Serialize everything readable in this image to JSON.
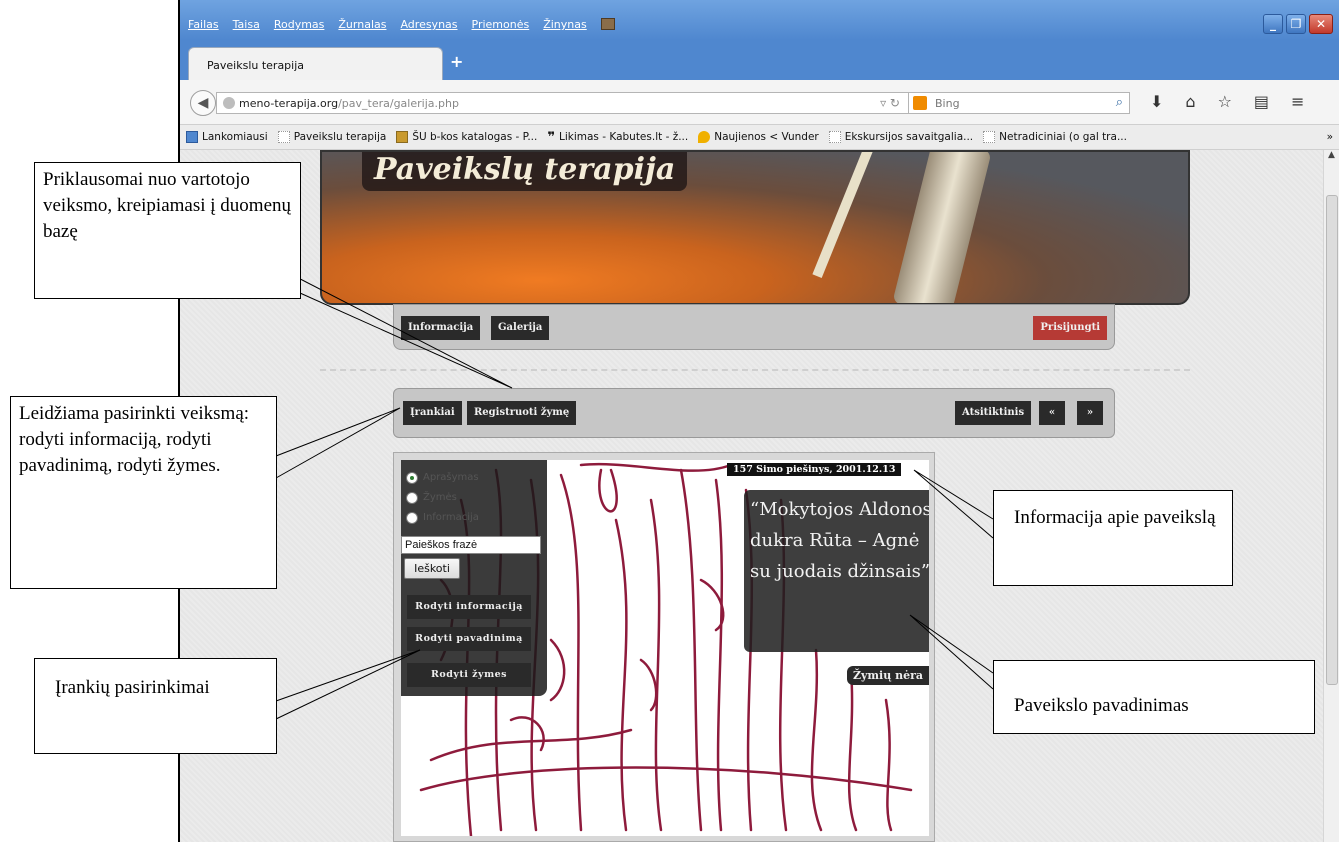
{
  "browser": {
    "menu": [
      "Failas",
      "Taisa",
      "Rodymas",
      "Žurnalas",
      "Adresynas",
      "Priemonės",
      "Žinynas"
    ],
    "tab_title": "Paveikslu terapija",
    "new_tab": "+",
    "url_host": "meno-terapija.org",
    "url_path": "/pav_tera/galerija.php",
    "search_placeholder": "Bing",
    "bookmarks": [
      "Lankomiausi",
      "Paveikslu terapija",
      "ŠU b-kos katalogas - P...",
      "Likimas - Kabutes.lt - ž...",
      "Naujienos < Vunder",
      "Ekskursijos savaitgalia...",
      "Netradiciniai (o gal tra..."
    ],
    "bookmarks_overflow": "»"
  },
  "site": {
    "banner_title": "Paveikslų terapija",
    "nav": {
      "info": "Informacija",
      "gallery": "Galerija",
      "login": "Prisijungti"
    },
    "toolbar": {
      "tools": "Įrankiai",
      "register": "Registruoti žymę",
      "random": "Atsitiktinis",
      "prev": "«",
      "next": "»"
    },
    "tools_panel": {
      "radio": [
        "Aprašymas",
        "Žymės",
        "Informacija"
      ],
      "search_value": "Paieškos frazė",
      "search_button": "Ieškoti",
      "show_info": "Rodyti informaciją",
      "show_title": "Rodyti pavadinimą",
      "show_tags": "Rodyti žymes"
    },
    "picture": {
      "info": "157 Simo piešinys, 2001.12.13",
      "title": "“Mokytojos Aldonos dukra Rūta – Agnė su juodais džinsais”",
      "tags": "Žymių nėra"
    }
  },
  "annotations": {
    "db": "Priklausomai nuo vartotojo  veiksmo, kreipiamasi į duomenų bazę",
    "actions": "Leidžiama pasirinkti veiksmą: rodyti informaciją, rodyti pavadinimą, rodyti žymes.",
    "tools": "Įrankių pasirinkimai",
    "info": "Informacija apie paveikslą",
    "title": "Paveikslo pavadinimas"
  },
  "colors": {
    "accent_blue": "#4f87cf",
    "login_red": "#b63a35",
    "drawing_ink": "#8e1b3c"
  }
}
